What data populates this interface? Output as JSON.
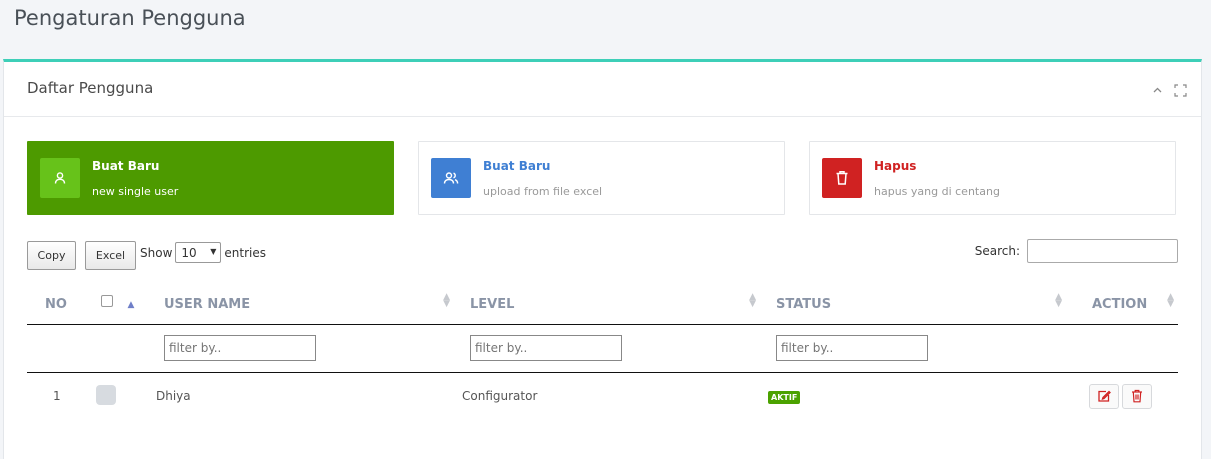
{
  "page": {
    "title": "Pengaturan Pengguna"
  },
  "panel": {
    "title": "Daftar Pengguna",
    "accent": "#3ecfb8"
  },
  "cards": [
    {
      "title": "Buat Baru",
      "subtitle": "new single user",
      "icon": "user-icon",
      "color": "#4d9a00"
    },
    {
      "title": "Buat Baru",
      "subtitle": "upload from file excel",
      "icon": "users-icon",
      "color": "#3f7fd3"
    },
    {
      "title": "Hapus",
      "subtitle": "hapus yang di centang",
      "icon": "trash-icon",
      "color": "#d02222"
    }
  ],
  "toolbar": {
    "copy_label": "Copy",
    "excel_label": "Excel",
    "show_label": "Show",
    "entries_value": "10",
    "entries_label": "entries",
    "search_label": "Search:"
  },
  "table": {
    "columns": [
      "NO",
      "",
      "USER NAME",
      "LEVEL",
      "STATUS",
      "ACTION"
    ],
    "filter_placeholder": "filter by..",
    "rows": [
      {
        "no": "1",
        "username": "Dhiya",
        "level": "Configurator",
        "status": "AKTIF"
      }
    ]
  }
}
